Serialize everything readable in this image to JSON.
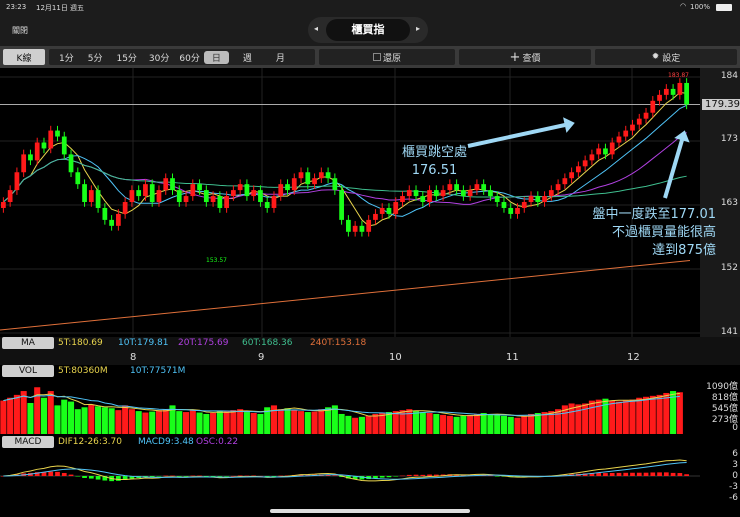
{
  "status": {
    "time": "23:23",
    "date": "12月11日 週五",
    "battery": "100%"
  },
  "header": {
    "close": "關閉",
    "title": "櫃買指"
  },
  "toolbar": {
    "kline": "K線",
    "periods": [
      "1分",
      "5分",
      "15分",
      "30分",
      "60分",
      "日",
      "週",
      "月"
    ],
    "restore": "還原",
    "query": "查價",
    "settings": "設定"
  },
  "colors": {
    "up": "#ff1a1a",
    "down": "#19ff19",
    "ma5": "#e8d44d",
    "ma10": "#4fc3f7",
    "ma20": "#b040e0",
    "ma60": "#3fbf8f",
    "ma240": "#e0703a",
    "annotation": "#9fd8f5"
  },
  "main": {
    "yticks": [
      "184",
      "173",
      "163",
      "152",
      "141"
    ],
    "yrange": [
      141,
      184
    ],
    "last_price": "179.39",
    "high_label": "183.87",
    "low_label": "153.57",
    "annotation1": [
      "櫃買跳空處",
      "176.51"
    ],
    "annotation2": [
      "盤中一度跌至177.01",
      "不過櫃買量能很高",
      "達到875億"
    ]
  },
  "ma": {
    "tag": "MA",
    "values": [
      "5T:180.69",
      "10T:179.81",
      "20T:175.69",
      "60T:168.36",
      "240T:153.18"
    ],
    "ma240_start": 141.5
  },
  "dates": [
    "8",
    "9",
    "10",
    "11",
    "12"
  ],
  "vol": {
    "tag": "VOL",
    "values": [
      "5T:80360M",
      "10T:77571M"
    ],
    "yticks": [
      "1090億",
      "818億",
      "545億",
      "273億",
      "0"
    ],
    "max": 1090
  },
  "macd": {
    "tag": "MACD",
    "values": [
      "DIF12-26:3.70",
      "MACD9:3.48",
      "OSC:0.22"
    ],
    "yticks": [
      "6",
      "3",
      "0",
      "-3",
      "-6"
    ]
  },
  "chart_data": {
    "type": "candlestick",
    "closes": [
      163,
      165,
      168,
      171,
      170,
      173,
      172,
      175,
      174,
      171,
      168,
      166,
      163,
      165,
      162,
      160,
      159,
      161,
      163,
      165,
      164,
      166,
      163,
      165,
      167,
      165,
      163,
      164,
      166,
      165,
      163,
      164,
      162,
      164,
      165,
      166,
      164,
      165,
      163,
      162,
      164,
      166,
      165,
      167,
      168,
      166,
      167,
      168,
      167,
      165,
      160,
      158,
      159,
      158,
      160,
      161,
      162,
      161,
      163,
      164,
      165,
      164,
      163,
      165,
      164,
      165,
      166,
      165,
      164,
      165,
      166,
      165,
      164,
      163,
      162,
      161,
      162,
      163,
      164,
      163,
      164,
      165,
      166,
      167,
      168,
      169,
      170,
      171,
      172,
      171,
      173,
      174,
      175,
      176,
      177,
      178,
      180,
      181,
      182,
      181,
      183,
      179.39
    ],
    "volumes": [
      700,
      760,
      820,
      900,
      650,
      980,
      760,
      900,
      600,
      720,
      680,
      520,
      560,
      620,
      580,
      560,
      540,
      500,
      600,
      520,
      480,
      450,
      470,
      500,
      520,
      600,
      480,
      460,
      500,
      450,
      420,
      440,
      480,
      470,
      500,
      520,
      460,
      440,
      420,
      560,
      600,
      520,
      540,
      500,
      480,
      460,
      470,
      520,
      560,
      600,
      420,
      380,
      340,
      360,
      380,
      420,
      440,
      460,
      480,
      500,
      520,
      480,
      460,
      440,
      420,
      400,
      380,
      360,
      380,
      400,
      420,
      440,
      420,
      400,
      380,
      360,
      340,
      380,
      420,
      440,
      460,
      480,
      520,
      600,
      640,
      620,
      640,
      700,
      720,
      740,
      700,
      680,
      700,
      720,
      760,
      780,
      800,
      820,
      860,
      900,
      875
    ]
  }
}
